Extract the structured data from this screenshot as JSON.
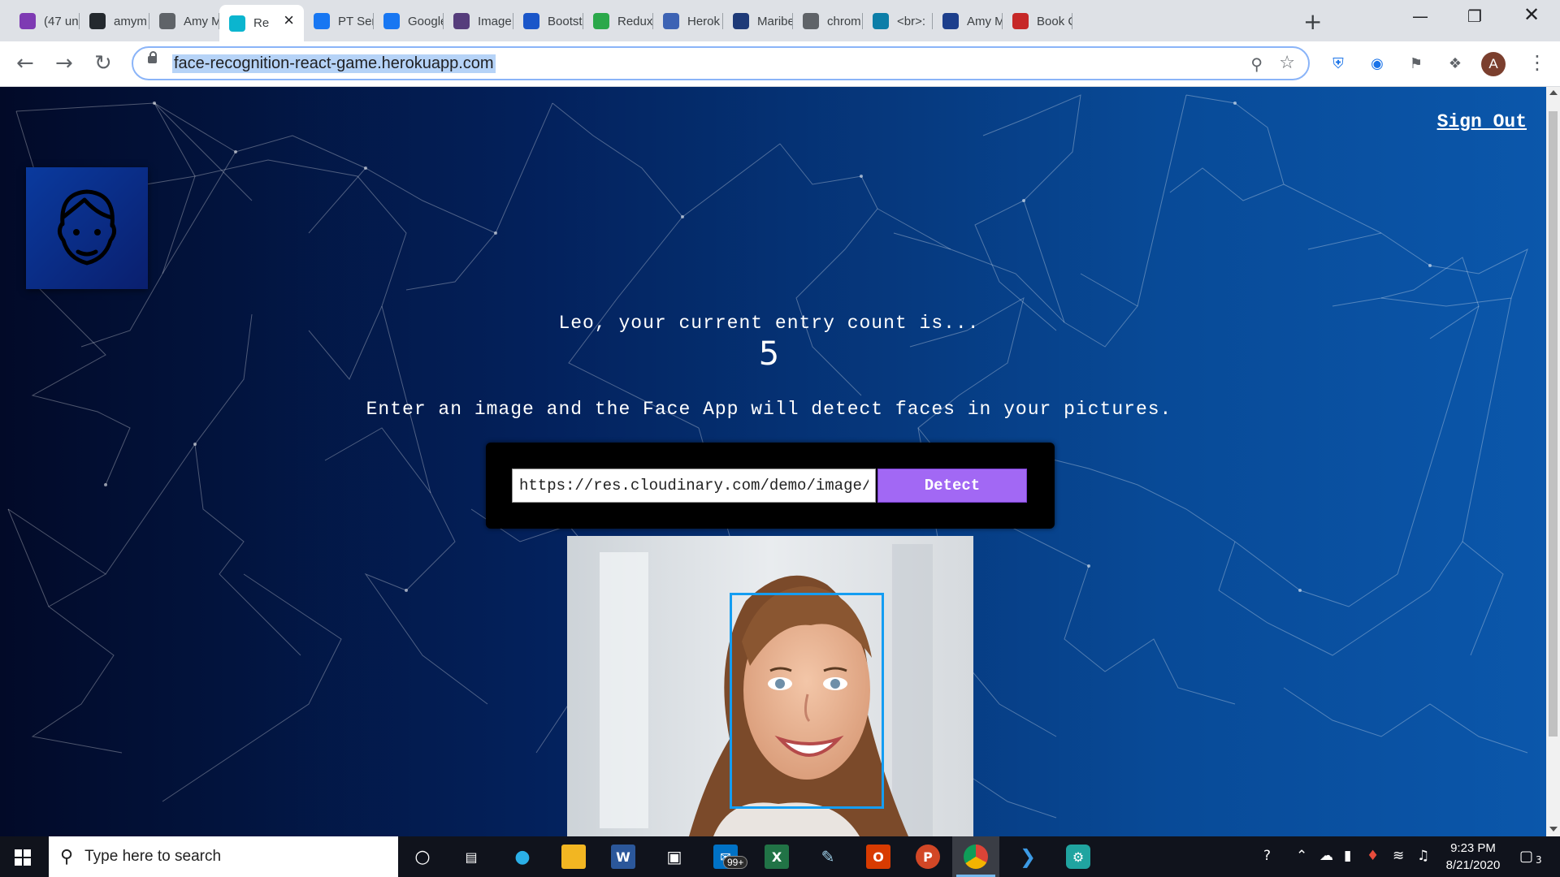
{
  "browser": {
    "tabs": [
      {
        "label": "(47 un",
        "icon": "gmail-icon",
        "color": "#7e3ab3"
      },
      {
        "label": "amym",
        "icon": "github-icon",
        "color": "#24292e"
      },
      {
        "label": "Amy M",
        "icon": "globe-icon",
        "color": "#5f6368"
      },
      {
        "label": "Re",
        "icon": "react-icon",
        "color": "#0bb5cf",
        "active": true
      },
      {
        "label": "PT Seri",
        "icon": "facebook-icon",
        "color": "#1877f2"
      },
      {
        "label": "Google",
        "icon": "facebook-icon",
        "color": "#1877f2"
      },
      {
        "label": "Image",
        "icon": "bootstrap-icon",
        "color": "#563d7c"
      },
      {
        "label": "Bootst",
        "icon": "flag-icon",
        "color": "#1a56c9"
      },
      {
        "label": "Redux",
        "icon": "redux-icon",
        "color": "#2ba84a"
      },
      {
        "label": "Herok",
        "icon": "search-icon",
        "color": "#3d63b4"
      },
      {
        "label": "Maribe",
        "icon": "heart-icon",
        "color": "#1e3a78"
      },
      {
        "label": "chrom",
        "icon": "globe-icon",
        "color": "#5f6368"
      },
      {
        "label": "<br>:",
        "icon": "bird-icon",
        "color": "#0d7ea8"
      },
      {
        "label": "Amy M",
        "icon": "am-logo-icon",
        "color": "#1d3f8c"
      },
      {
        "label": "Book C",
        "icon": "book-icon",
        "color": "#c62828"
      }
    ],
    "address": "face-recognition-react-game.herokuapp.com",
    "profile_initial": "A"
  },
  "app": {
    "signout_label": "Sign Out",
    "welcome_text": "Leo, your current entry count is...",
    "entry_count": "5",
    "instructions": "Enter an image and the Face App will detect faces in your pictures.",
    "input_value": "https://res.cloudinary.com/demo/image/upload/face_left.jpg",
    "detect_label": "Detect"
  },
  "taskbar": {
    "search_placeholder": "Type here to search",
    "mail_badge": "99+",
    "time": "9:23 PM",
    "date": "8/21/2020",
    "notification_count": "3"
  }
}
